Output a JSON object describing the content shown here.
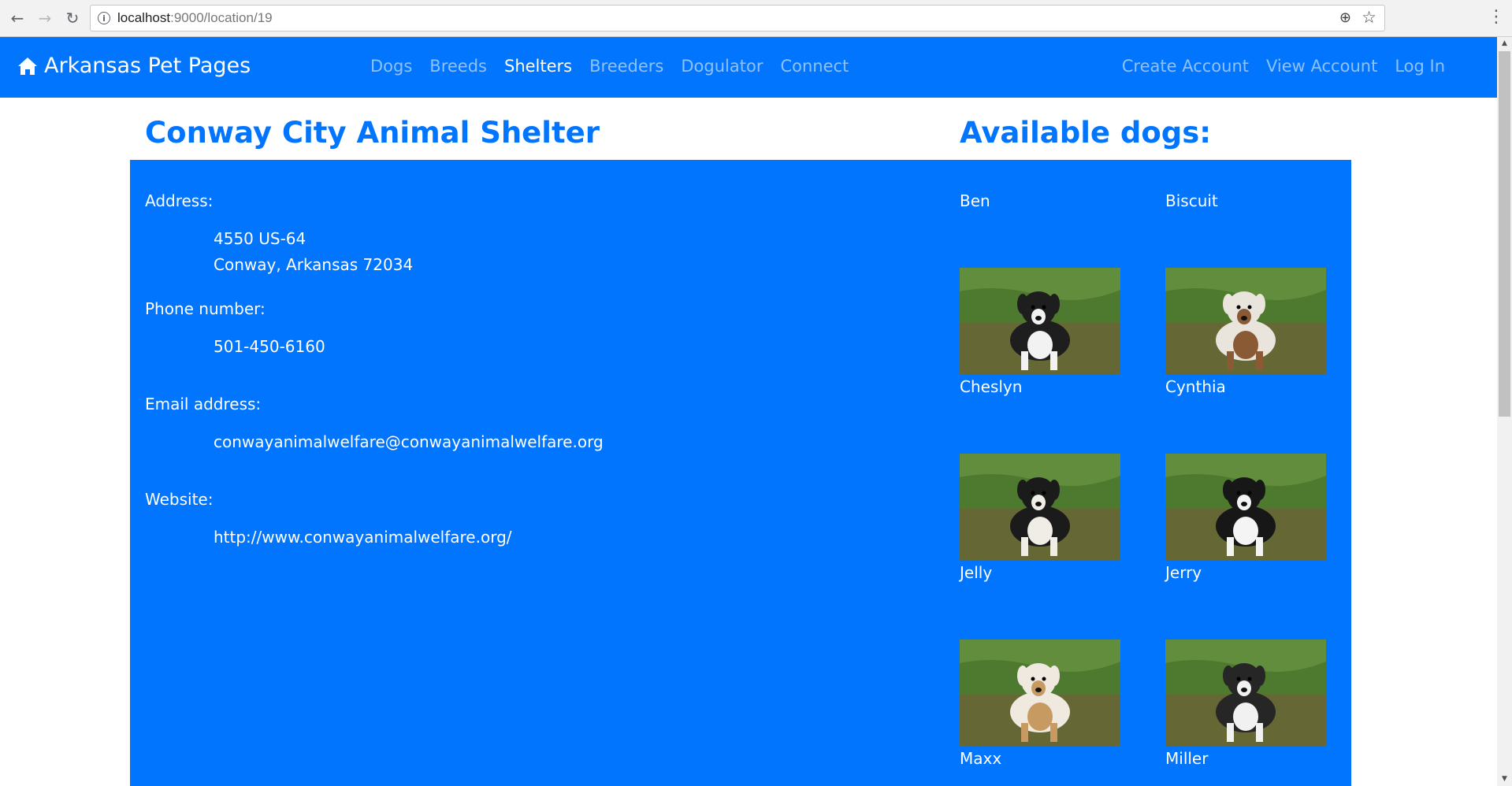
{
  "browser": {
    "url_host": "localhost",
    "url_path": ":9000/location/19"
  },
  "navbar": {
    "brand": "Arkansas Pet Pages",
    "links": [
      {
        "label": "Dogs",
        "active": false
      },
      {
        "label": "Breeds",
        "active": false
      },
      {
        "label": "Shelters",
        "active": true
      },
      {
        "label": "Breeders",
        "active": false
      },
      {
        "label": "Dogulator",
        "active": false
      },
      {
        "label": "Connect",
        "active": false
      }
    ],
    "right_links": [
      "Create Account",
      "View Account",
      "Log In"
    ]
  },
  "shelter": {
    "name": "Conway City Animal Shelter",
    "address_label": "Address:",
    "address_line1": "4550 US-64",
    "address_line2": "Conway, Arkansas 72034",
    "phone_label": "Phone number:",
    "phone": "501-450-6160",
    "email_label": "Email address:",
    "email": "conwayanimalwelfare@conwayanimalwelfare.org",
    "website_label": "Website:",
    "website": "http://www.conwayanimalwelfare.org/"
  },
  "dogs_heading": "Available dogs:",
  "dogs": [
    {
      "name": "Ben"
    },
    {
      "name": "Biscuit"
    },
    {
      "name": "Cheslyn"
    },
    {
      "name": "Cynthia"
    },
    {
      "name": "Jelly"
    },
    {
      "name": "Jerry"
    },
    {
      "name": "Maxx"
    },
    {
      "name": "Miller"
    }
  ],
  "colors": {
    "accent": "#0275fe",
    "grass": "#4d7a2e",
    "dirt": "#7a5a3c"
  }
}
